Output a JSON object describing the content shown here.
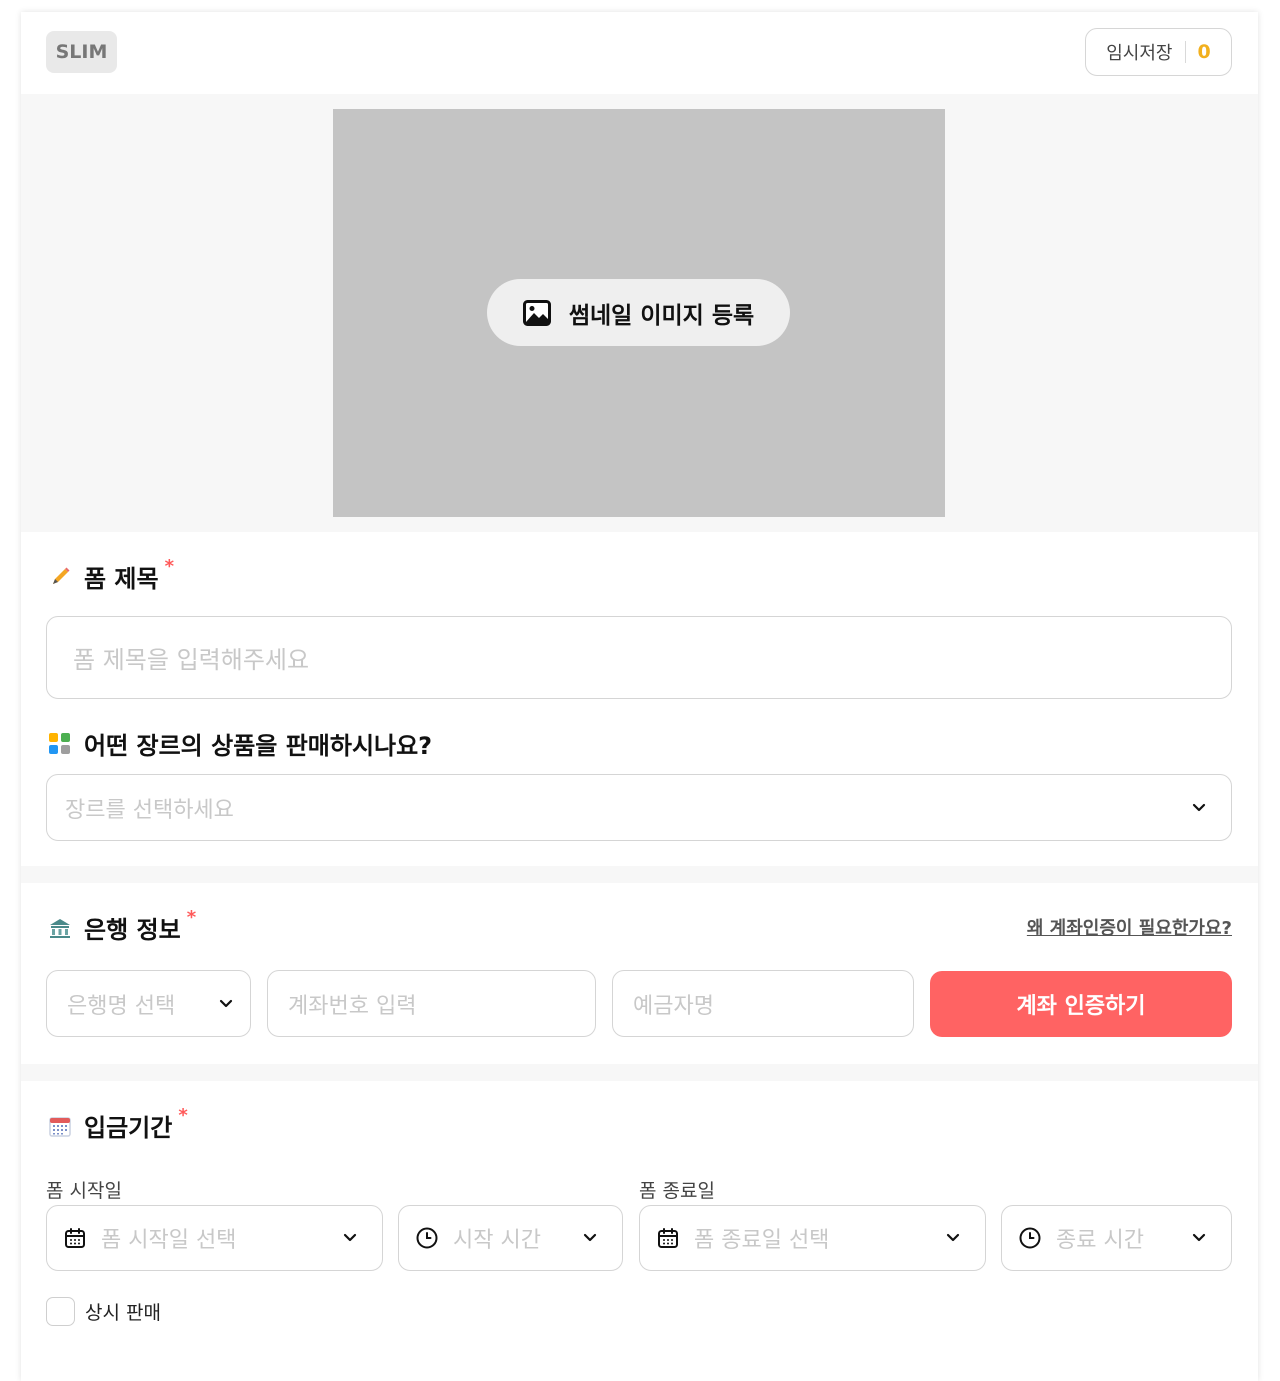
{
  "header": {
    "brand": "SLIM",
    "draft_label": "임시저장",
    "draft_count": "0"
  },
  "thumbnail": {
    "button_label": "썸네일 이미지 등록"
  },
  "form_title": {
    "label": "폼 제목",
    "required_mark": "*",
    "placeholder": "폼 제목을 입력해주세요"
  },
  "genre": {
    "label": "어떤 장르의 상품을 판매하시나요?",
    "placeholder": "장르를 선택하세요"
  },
  "bank": {
    "label": "은행 정보",
    "required_mark": "*",
    "help_link": "왜 계좌인증이 필요한가요?",
    "bank_select_placeholder": "은행명 선택",
    "account_placeholder": "계좌번호 입력",
    "holder_placeholder": "예금자명",
    "verify_button": "계좌 인증하기"
  },
  "period": {
    "label": "입금기간",
    "required_mark": "*",
    "start_label": "폼 시작일",
    "end_label": "폼 종료일",
    "start_date_placeholder": "폼 시작일 선택",
    "start_time_placeholder": "시작 시간",
    "end_date_placeholder": "폼 종료일 선택",
    "end_time_placeholder": "종료 시간",
    "always_on_sale": "상시 판매"
  },
  "colors": {
    "accent": "#ff6363",
    "draft_count": "#f2b01e",
    "required": "#ff5a5a"
  }
}
